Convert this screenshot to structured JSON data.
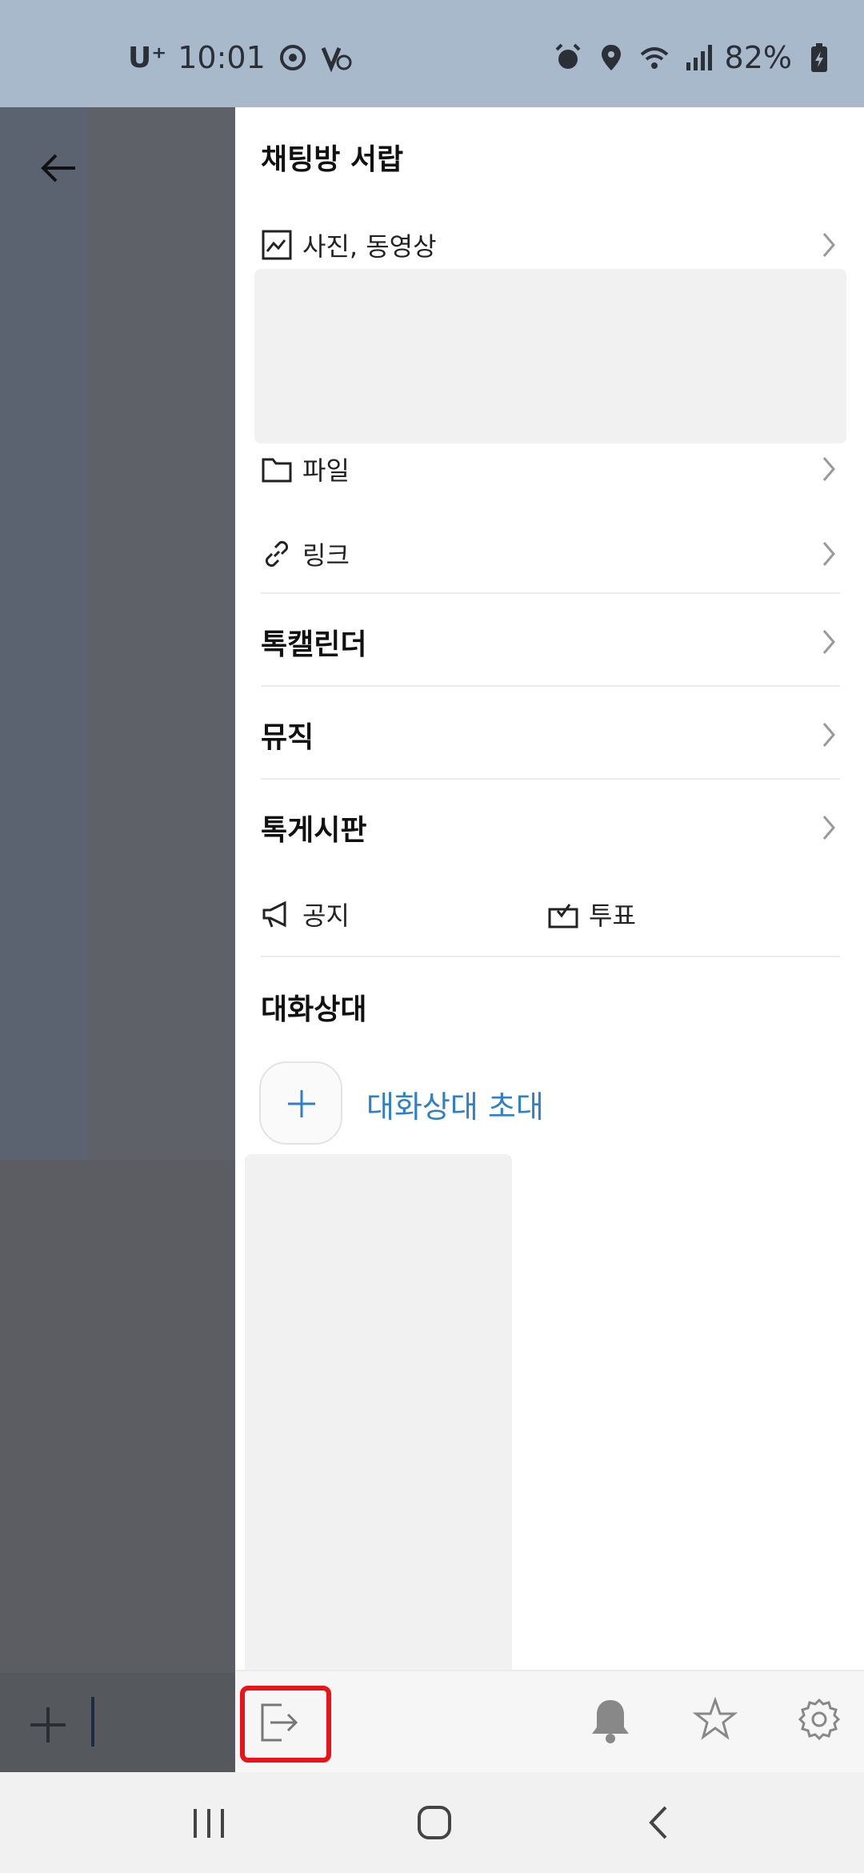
{
  "status_bar": {
    "carrier": "U⁺",
    "time": "10:01",
    "battery": "82%"
  },
  "drawer": {
    "title": "채팅방 서랍",
    "items": {
      "photos": "사진, 동영상",
      "files": "파일",
      "links": "링크"
    },
    "sections": {
      "talk_calendar": "톡캘린더",
      "music": "뮤직",
      "talk_board": "톡게시판",
      "members": "대화상대"
    },
    "board_actions": {
      "notice": "공지",
      "vote": "투표"
    },
    "invite_label": "대화상대 초대"
  },
  "colors": {
    "accent": "#2f7fc9",
    "highlight": "#e8141a",
    "status_bar_bg": "#a9b9cc"
  }
}
